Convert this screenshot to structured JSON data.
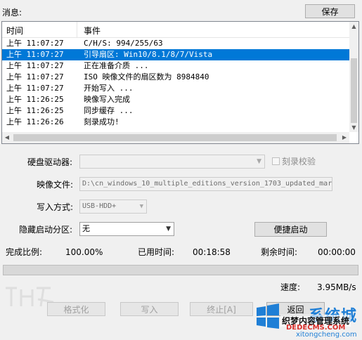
{
  "messages_label": "消息:",
  "save_button": "保存",
  "log": {
    "columns": [
      "时间",
      "事件"
    ],
    "rows": [
      {
        "time": "上午 11:07:27",
        "event": "C/H/S: 994/255/63"
      },
      {
        "time": "上午 11:07:27",
        "event": "引导扇区: Win10/8.1/8/7/Vista",
        "selected": true
      },
      {
        "time": "上午 11:07:27",
        "event": "正在准备介质 ..."
      },
      {
        "time": "上午 11:07:27",
        "event": "ISO 映像文件的扇区数为 8984840"
      },
      {
        "time": "上午 11:07:27",
        "event": "开始写入 ..."
      },
      {
        "time": "上午 11:26:25",
        "event": "映像写入完成"
      },
      {
        "time": "上午 11:26:25",
        "event": "同步缓存 ..."
      },
      {
        "time": "上午 11:26:26",
        "event": "刻录成功!"
      }
    ]
  },
  "form": {
    "drive_label": "硬盘驱动器:",
    "drive_value": "",
    "verify_label": "刻录校验",
    "image_label": "映像文件:",
    "image_value": "D:\\cn_windows_10_multiple_editions_version_1703_updated_mar",
    "write_mode_label": "写入方式:",
    "write_mode_value": "USB-HDD+",
    "hidden_partition_label": "隐藏启动分区:",
    "hidden_partition_value": "无",
    "quick_boot_button": "便捷启动"
  },
  "status": {
    "completion_label": "完成比例:",
    "completion_value": "100.00%",
    "elapsed_label": "已用时间:",
    "elapsed_value": "00:18:58",
    "remaining_label": "剩余时间:",
    "remaining_value": "00:00:00",
    "progress_fraction": 1.0,
    "speed_label": "速度:",
    "speed_value": "3.95MB/s"
  },
  "buttons": {
    "format": "格式化",
    "write": "写入",
    "abort": "终止[A]",
    "back": "返回"
  },
  "watermark": {
    "brand_name": "系统城",
    "site_name": "织梦内容管理系统",
    "site_domain": "DEDECMS.COM",
    "site_url": "xitongcheng.com"
  },
  "colors": {
    "selection": "#0078d7",
    "brand_blue": "#1f7fd6",
    "brand_red": "#d9302c"
  }
}
